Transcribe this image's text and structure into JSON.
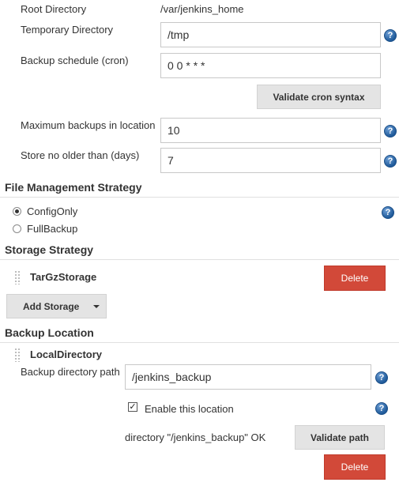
{
  "general": {
    "root_directory_label": "Root Directory",
    "root_directory_value": "/var/jenkins_home",
    "temporary_directory_label": "Temporary Directory",
    "temporary_directory_value": "/tmp",
    "backup_schedule_label": "Backup schedule (cron)",
    "backup_schedule_value": "0 0 * * *",
    "validate_cron_label": "Validate cron syntax",
    "max_backups_label": "Maximum backups in location",
    "max_backups_value": "10",
    "store_no_older_label": "Store no older than (days)",
    "store_no_older_value": "7"
  },
  "file_management": {
    "title": "File Management Strategy",
    "options": [
      {
        "label": "ConfigOnly",
        "selected": true
      },
      {
        "label": "FullBackup",
        "selected": false
      }
    ]
  },
  "storage": {
    "title": "Storage Strategy",
    "item_name": "TarGzStorage",
    "delete_label": "Delete",
    "add_label": "Add Storage"
  },
  "backup_location": {
    "title": "Backup Location",
    "item_name": "LocalDirectory",
    "path_label": "Backup directory path",
    "path_value": "/jenkins_backup",
    "enable_label": "Enable this location",
    "enable_checked": true,
    "status_text": "directory \"/jenkins_backup\" OK",
    "validate_path_label": "Validate path",
    "delete_label": "Delete"
  },
  "icons": {
    "help": "help-icon",
    "dropdown": "caret-down-icon",
    "drag": "drag-handle-icon"
  },
  "colors": {
    "delete_button": "#d24939",
    "grey_button": "#e4e4e4",
    "help_icon": "#2e6db4"
  }
}
